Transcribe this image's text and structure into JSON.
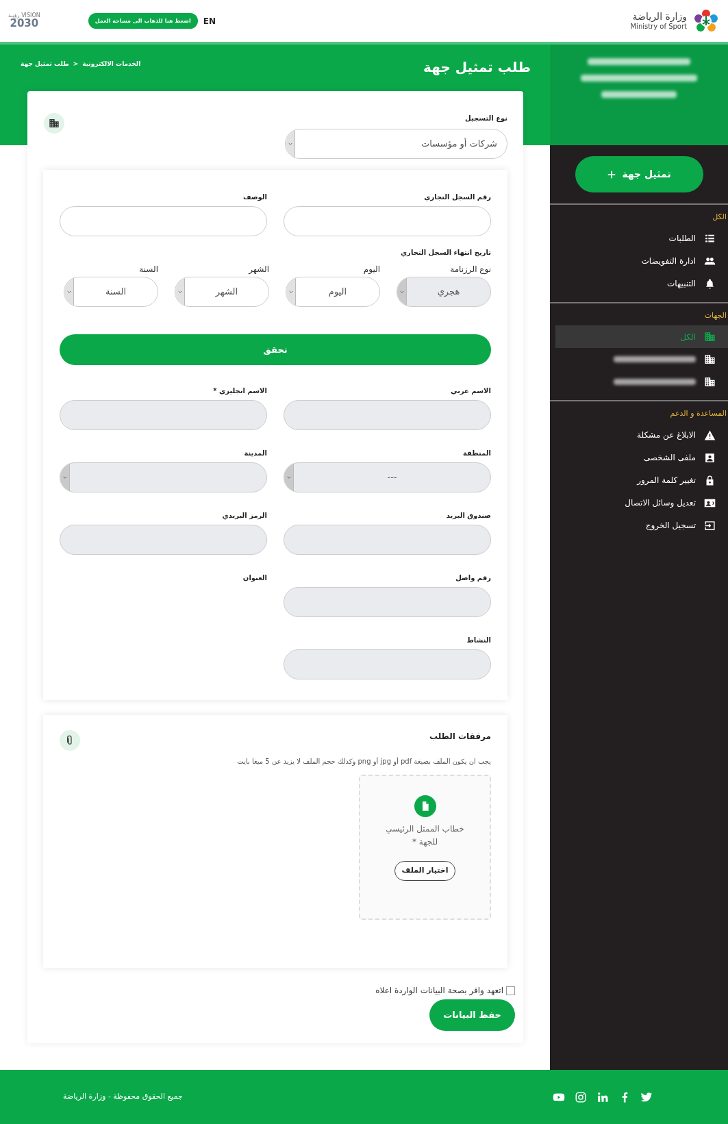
{
  "header": {
    "logo_title": "وزارة الرياضة",
    "logo_subtitle": "Ministry of Sport",
    "language": "EN",
    "workspace_button": "اضغط هنا للذهاب الى مساحه العمل",
    "vision_logo": {
      "label": "VISION رؤيـة",
      "year": "2030"
    }
  },
  "sidebar": {
    "add_button": "تمثيل جهة",
    "sections": [
      {
        "title": "الكل",
        "items": [
          {
            "label": "الطلبات",
            "kind": "list",
            "selected": false
          },
          {
            "label": "ادارة التفويضات",
            "kind": "users",
            "selected": false
          },
          {
            "label": "التنبيهات",
            "kind": "bell",
            "selected": false
          }
        ]
      },
      {
        "title": "الجهات",
        "items": [
          {
            "label": "الكل",
            "kind": "building",
            "selected": true
          },
          {
            "kind": "building",
            "selected": false
          },
          {
            "kind": "building",
            "selected": false
          }
        ]
      },
      {
        "title": "المساعدة و الدعم",
        "items": [
          {
            "label": "الابلاغ عن مشكلة",
            "kind": "warning",
            "selected": false
          },
          {
            "label": "ملفى الشخصى",
            "kind": "profile",
            "selected": false
          },
          {
            "label": "تغيير كلمة المرور",
            "kind": "lock",
            "selected": false
          },
          {
            "label": "تعديل وسائل الاتصال",
            "kind": "contact",
            "selected": false
          },
          {
            "label": "تسجيل الخروج",
            "kind": "logout",
            "selected": false
          }
        ]
      }
    ]
  },
  "page": {
    "title": "طلب تمثيل جهة",
    "breadcrumb": [
      "الخدمات الالكترونية",
      "طلب تمثيل جهة"
    ],
    "breadcrumb_separator": ">"
  },
  "registration_type": {
    "label": "نوع التسجيل",
    "value": "شركات أو مؤسسات"
  },
  "register_fields": [
    {
      "kind": "input",
      "label": "رقم السجل التجاري",
      "disabled": false
    },
    {
      "kind": "input",
      "label": "الوصف",
      "disabled": false
    }
  ],
  "expiry_date": {
    "title": "تاريخ انتهاء السجل التجاري",
    "selects": [
      {
        "label": "نوع الرزنامة",
        "value": "هجري",
        "disabled": true
      },
      {
        "label": "اليوم",
        "value": "اليوم",
        "disabled": false
      },
      {
        "label": "الشهر",
        "value": "الشهر",
        "disabled": false
      },
      {
        "label": "السنة",
        "value": "السنة",
        "disabled": false
      }
    ]
  },
  "verify_button": "تحقق",
  "entity_fields": [
    {
      "kind": "input",
      "label": "الاسم عربي",
      "disabled": true
    },
    {
      "kind": "input",
      "label": "الاسم انجليزي *",
      "disabled": true
    },
    {
      "kind": "select",
      "label": "المنطقة",
      "value": "---",
      "disabled": true
    },
    {
      "kind": "select",
      "label": "المدينة",
      "disabled": true
    },
    {
      "kind": "input",
      "label": "صندوق البريد",
      "disabled": true
    },
    {
      "kind": "input",
      "label": "الرمز البريدي",
      "disabled": true
    },
    {
      "kind": "input",
      "label": "رقم واصل",
      "disabled": true
    },
    {
      "kind": "label",
      "label": "العنوان"
    },
    {
      "kind": "input",
      "label": "النشاط",
      "disabled": true
    }
  ],
  "attachments": {
    "title": "مرفقات الطلب",
    "note": "يجب ان يكون الملف بصيغة pdf أو jpg أو png وكذلك حجم الملف لا يزيد عن 5 ميغا بايت",
    "files": [
      {
        "label": "خطاب الممثل الرئيسي للجهة *",
        "button": "اختيار الملف"
      }
    ]
  },
  "agreement": {
    "label": "اتعهد واقر بصحة البيانات الواردة اعلاه",
    "checked": false
  },
  "save_button": "حفظ البيانات",
  "footer": {
    "copyright": "جميع الحقوق محفوظة - وزارة الرياضة",
    "social": [
      {
        "kind": "twitter"
      },
      {
        "kind": "facebook"
      },
      {
        "kind": "linkedin"
      },
      {
        "kind": "instagram"
      },
      {
        "kind": "youtube"
      }
    ]
  }
}
